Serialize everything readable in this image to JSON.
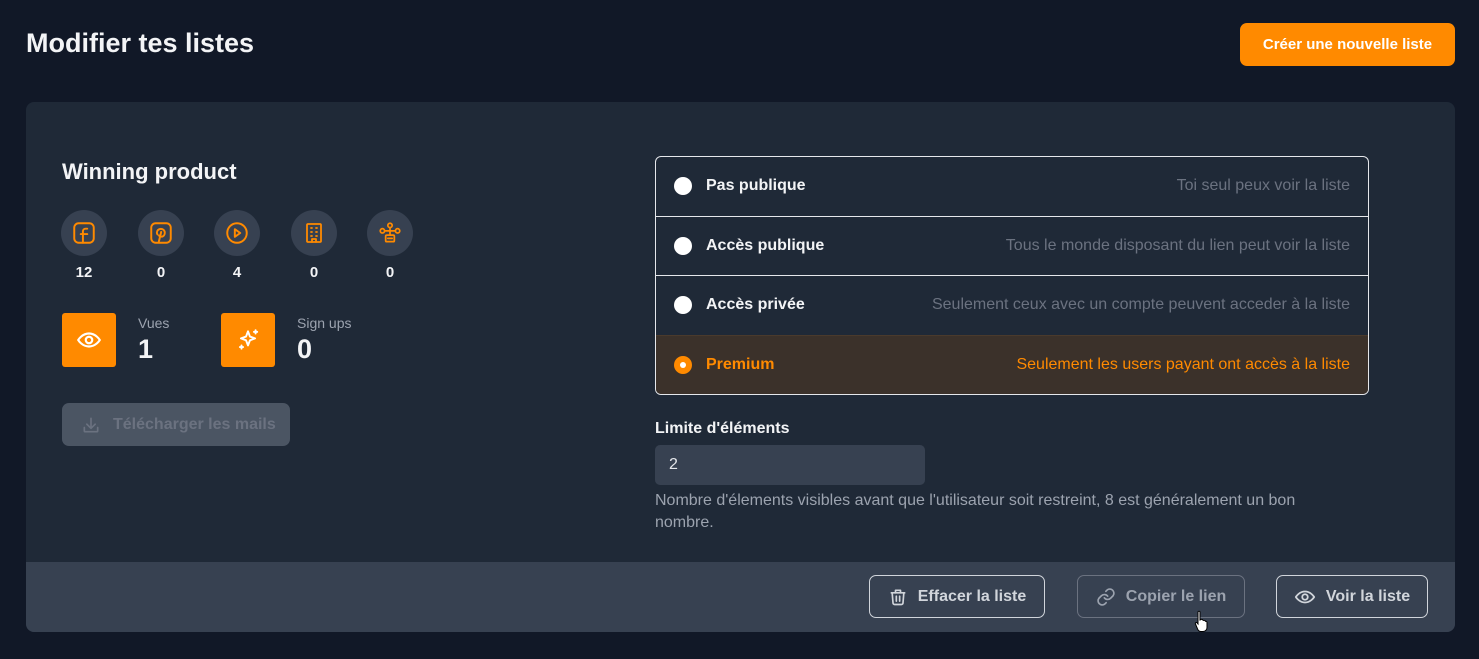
{
  "header": {
    "title": "Modifier tes listes",
    "create_label": "Créer une nouvelle liste"
  },
  "list": {
    "name": "Winning product",
    "sources": [
      {
        "icon": "facebook-icon",
        "count": "12"
      },
      {
        "icon": "pinterest-icon",
        "count": "0"
      },
      {
        "icon": "play-circle-icon",
        "count": "4"
      },
      {
        "icon": "building-icon",
        "count": "0"
      },
      {
        "icon": "network-icon",
        "count": "0"
      }
    ],
    "stats": {
      "views_label": "Vues",
      "views_value": "1",
      "signups_label": "Sign ups",
      "signups_value": "0"
    },
    "download_label": "Télécharger les mails"
  },
  "visibility": {
    "selected": "premium",
    "options": [
      {
        "label": "Pas publique",
        "desc": "Toi seul peux voir la liste"
      },
      {
        "label": "Accès publique",
        "desc": "Tous le monde disposant du lien peut voir la liste"
      },
      {
        "label": "Accès privée",
        "desc": "Seulement ceux avec un compte peuvent acceder à la liste"
      },
      {
        "label": "Premium",
        "desc": "Seulement les users payant ont accès à la liste"
      }
    ]
  },
  "limit": {
    "label": "Limite d'éléments",
    "value": "2",
    "help": "Nombre d'élements visibles avant que l'utilisateur soit restreint, 8 est généralement un bon nombre."
  },
  "footer": {
    "delete_label": "Effacer la liste",
    "copy_label": "Copier le lien",
    "view_label": "Voir la liste"
  },
  "colors": {
    "accent": "#ff8a00",
    "background": "#111827",
    "card": "#1f2937",
    "footer": "#374151"
  }
}
